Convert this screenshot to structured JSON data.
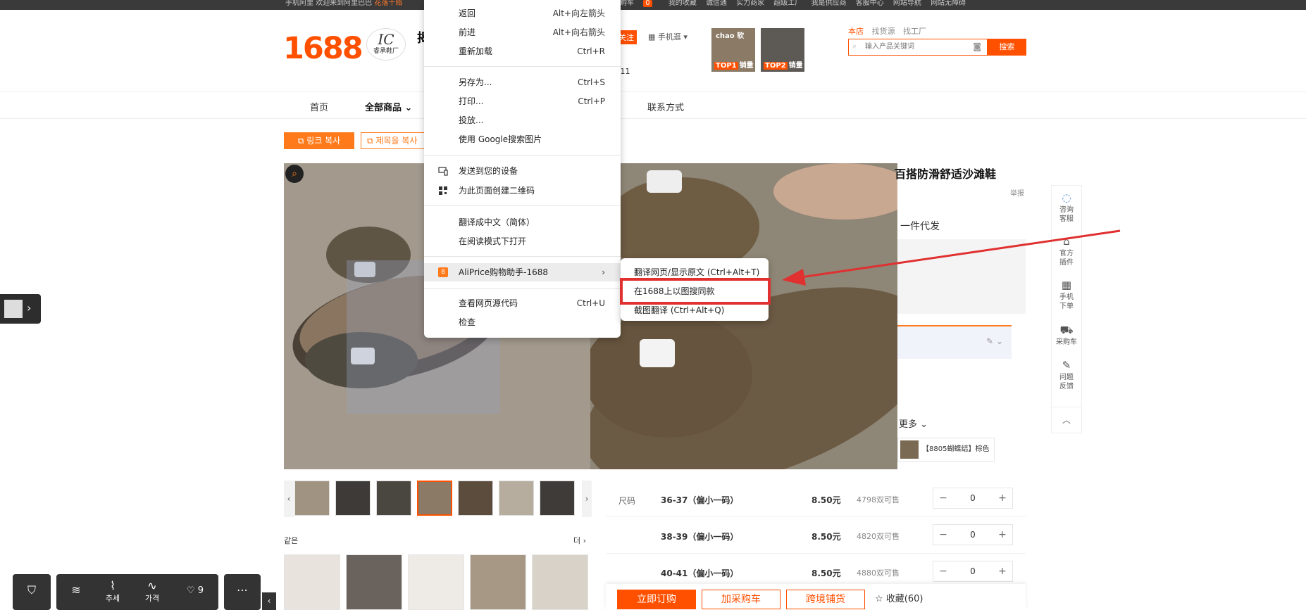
{
  "topbar": {
    "left_text": "手机阿里 欢迎来到阿里巴巴",
    "left_highlight": "花落千络",
    "cart_label": "采购车",
    "cart_count": "0",
    "items": [
      "我的收藏",
      "诚信通",
      "实力商家",
      "超级工厂",
      "我是供应商",
      "客服中心",
      "网站导航",
      "网站无障碍"
    ]
  },
  "header": {
    "logo": "1688",
    "shop_logo_mark": "IC",
    "shop_logo_text": "睿承鞋厂",
    "shop_name_fragment": "揭",
    "follow_label": "关注",
    "mobile_shop_label": "手机逛",
    "rank_fragment": "第 11",
    "top_items": [
      {
        "badge": "TOP1",
        "label": "销量"
      },
      {
        "badge": "TOP2",
        "label": "销量"
      }
    ],
    "top_item_caption": "chao 软",
    "search_tabs": [
      "本店",
      "找货源",
      "找工厂"
    ],
    "search_placeholder": "输入产品关键词",
    "search_button": "搜索"
  },
  "nav": {
    "home": "首页",
    "all_products": "全部商品",
    "contact": "联系方式"
  },
  "copy_buttons": {
    "link": "링크 복사",
    "title": "제목을 복사"
  },
  "product": {
    "title_fragment": "百搭防滑舒适沙滩鞋",
    "report": "举报",
    "dropship": "一件代发",
    "more": "更多",
    "color_chip": "【8805蝴蝶结】棕色",
    "size_label": "尺码",
    "sizes": [
      {
        "name": "36-37（偏小一码）",
        "price": "8.50元",
        "stock": "4798双可售",
        "qty": "0"
      },
      {
        "name": "38-39（偏小一码）",
        "price": "8.50元",
        "stock": "4820双可售",
        "qty": "0"
      },
      {
        "name": "40-41（偏小一码）",
        "price": "8.50元",
        "stock": "4880双可售",
        "qty": "0"
      }
    ],
    "similar_title": "같은",
    "similar_more": "더"
  },
  "actions": {
    "buy_now": "立即订购",
    "add_cart": "加采购车",
    "cross_border": "跨境铺货",
    "favorite": "收藏(60)"
  },
  "right_tools": [
    {
      "icon": "chat-icon",
      "label": "咨询\n客服"
    },
    {
      "icon": "plugin-icon",
      "label": "官方\n插件"
    },
    {
      "icon": "qrcode-icon",
      "label": "手机\n下单"
    },
    {
      "icon": "cart-icon",
      "label": "采购车"
    },
    {
      "icon": "edit-icon",
      "label": "问题\n反馈"
    }
  ],
  "bottom_toolbar": {
    "trend": "추세",
    "price": "가격",
    "likes": "9"
  },
  "context_menu": {
    "items": [
      {
        "label": "返回",
        "shortcut": "Alt+向左箭头"
      },
      {
        "label": "前进",
        "shortcut": "Alt+向右箭头"
      },
      {
        "label": "重新加载",
        "shortcut": "Ctrl+R"
      },
      {
        "label": "另存为...",
        "shortcut": "Ctrl+S"
      },
      {
        "label": "打印...",
        "shortcut": "Ctrl+P"
      },
      {
        "label": "投放...",
        "shortcut": ""
      },
      {
        "label": "使用 Google搜索图片",
        "shortcut": ""
      },
      {
        "label": "发送到您的设备",
        "shortcut": ""
      },
      {
        "label": "为此页面创建二维码",
        "shortcut": ""
      },
      {
        "label": "翻译成中文（简体）",
        "shortcut": ""
      },
      {
        "label": "在阅读模式下打开",
        "shortcut": ""
      },
      {
        "label": "AliPrice购物助手-1688",
        "shortcut": ""
      },
      {
        "label": "查看网页源代码",
        "shortcut": "Ctrl+U"
      },
      {
        "label": "检查",
        "shortcut": ""
      }
    ],
    "submenu": [
      {
        "label": "翻译网页/显示原文 (Ctrl+Alt+T)"
      },
      {
        "label": "在1688上以图搜同款"
      },
      {
        "label": "截图翻译 (Ctrl+Alt+Q)"
      }
    ]
  },
  "colors": {
    "brand": "#ff5000",
    "highlight_box": "#e03030"
  }
}
